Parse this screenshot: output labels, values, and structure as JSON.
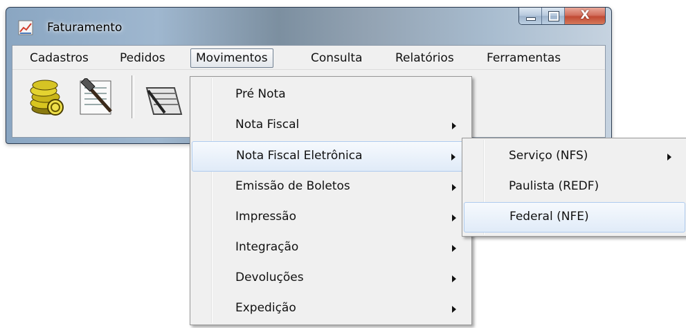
{
  "window": {
    "title": "Faturamento",
    "app_icon": "chart-document-icon"
  },
  "caption_buttons": {
    "minimize_icon": "minimize-icon",
    "maximize_icon": "maximize-icon",
    "close_glyph": "X"
  },
  "menubar": {
    "items": [
      "Cadastros",
      "Pedidos",
      "Movimentos",
      "Consulta",
      "Relatórios",
      "Ferramentas"
    ],
    "active": "Movimentos"
  },
  "toolbar": {
    "icons": [
      "coins-icon",
      "hammer-form-icon",
      "document-icon",
      "document-icon"
    ]
  },
  "movimentos_menu": {
    "items": [
      {
        "label": "Pré Nota",
        "submenu": false
      },
      {
        "label": "Nota Fiscal",
        "submenu": true
      },
      {
        "label": "Nota Fiscal Eletrônica",
        "submenu": true,
        "highlighted": true
      },
      {
        "label": "Emissão de Boletos",
        "submenu": true
      },
      {
        "label": "Impressão",
        "submenu": true
      },
      {
        "label": "Integração",
        "submenu": true
      },
      {
        "label": "Devoluções",
        "submenu": true
      },
      {
        "label": "Expedição",
        "submenu": true
      }
    ]
  },
  "nfe_submenu": {
    "items": [
      {
        "label": "Serviço (NFS)",
        "submenu": true
      },
      {
        "label": "Paulista (REDF)",
        "submenu": false
      },
      {
        "label": "Federal (NFE)",
        "submenu": false,
        "highlighted": true
      }
    ]
  },
  "colors": {
    "highlight_border": "#aecbee",
    "menu_bg": "#f0f0f0",
    "close_button": "#c14a34"
  }
}
